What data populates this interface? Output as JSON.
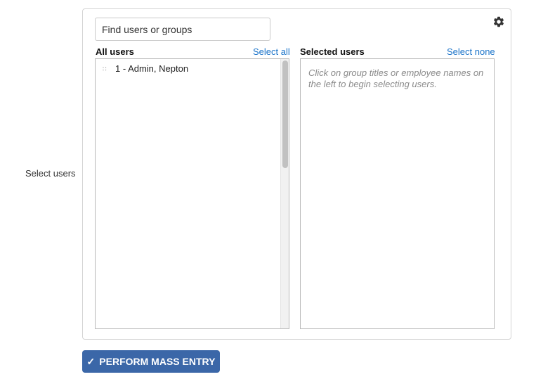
{
  "form": {
    "row_label": "Select users"
  },
  "search": {
    "placeholder": "Find users or groups",
    "value": ""
  },
  "settings": {
    "icon": "gear-icon"
  },
  "all_users": {
    "title": "All users",
    "select_all_label": "Select all",
    "items": [
      {
        "label": "1 - Admin, Nepton"
      }
    ]
  },
  "selected_users": {
    "title": "Selected users",
    "select_none_label": "Select none",
    "empty_hint": "Click on group titles or employee names on the left to begin selecting users."
  },
  "actions": {
    "perform_label": "PERFORM MASS ENTRY",
    "perform_icon": "check-icon"
  },
  "colors": {
    "link": "#1a73c9",
    "primary_button": "#3b67a8",
    "border": "#d4d4d4"
  }
}
